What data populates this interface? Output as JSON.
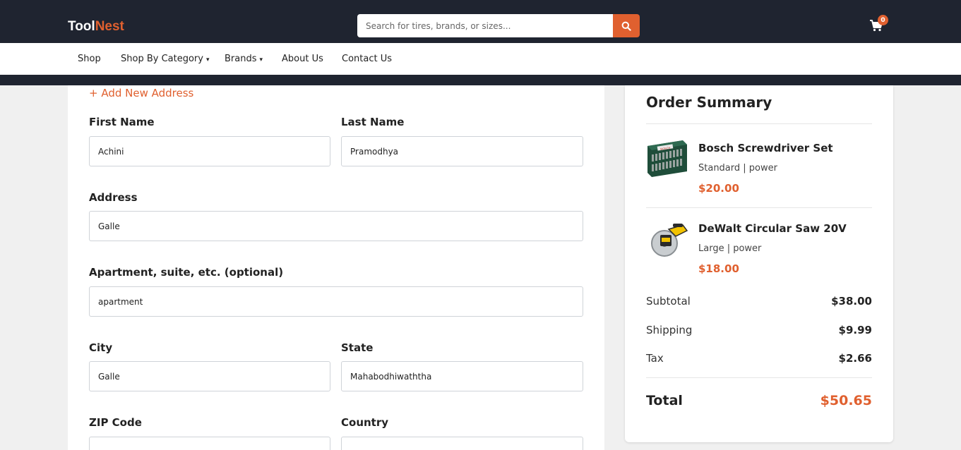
{
  "brand": {
    "part1": "Tool",
    "part2": "Nest"
  },
  "search": {
    "placeholder": "Search for tires, brands, or sizes..."
  },
  "cart": {
    "count": "0"
  },
  "nav": {
    "shop": "Shop",
    "category": "Shop By Category",
    "brands": "Brands",
    "about": "About Us",
    "contact": "Contact Us",
    "caret": "▾"
  },
  "form": {
    "add_address": "+ Add New Address",
    "first_name": {
      "label": "First Name",
      "value": "Achini"
    },
    "last_name": {
      "label": "Last Name",
      "value": "Pramodhya"
    },
    "address": {
      "label": "Address",
      "value": "Galle"
    },
    "apartment": {
      "label": "Apartment, suite, etc. (optional)",
      "value": "apartment"
    },
    "city": {
      "label": "City",
      "value": "Galle"
    },
    "state": {
      "label": "State",
      "value": "Mahabodhiwaththa"
    },
    "zip": {
      "label": "ZIP Code",
      "value": ""
    },
    "country": {
      "label": "Country",
      "value": ""
    }
  },
  "summary": {
    "title": "Order Summary",
    "items": [
      {
        "name": "Bosch Screwdriver Set",
        "variant": "Standard | power",
        "price": "$20.00",
        "image": "screwdriver-set-image"
      },
      {
        "name": "DeWalt Circular Saw 20V",
        "variant": "Large | power",
        "price": "$18.00",
        "image": "circular-saw-image"
      }
    ],
    "subtotal_label": "Subtotal",
    "subtotal": "$38.00",
    "shipping_label": "Shipping",
    "shipping": "$9.99",
    "tax_label": "Tax",
    "tax": "$2.66",
    "total_label": "Total",
    "total": "$50.65"
  },
  "colors": {
    "accent": "#e0602f",
    "header_bg": "#1f2430"
  }
}
